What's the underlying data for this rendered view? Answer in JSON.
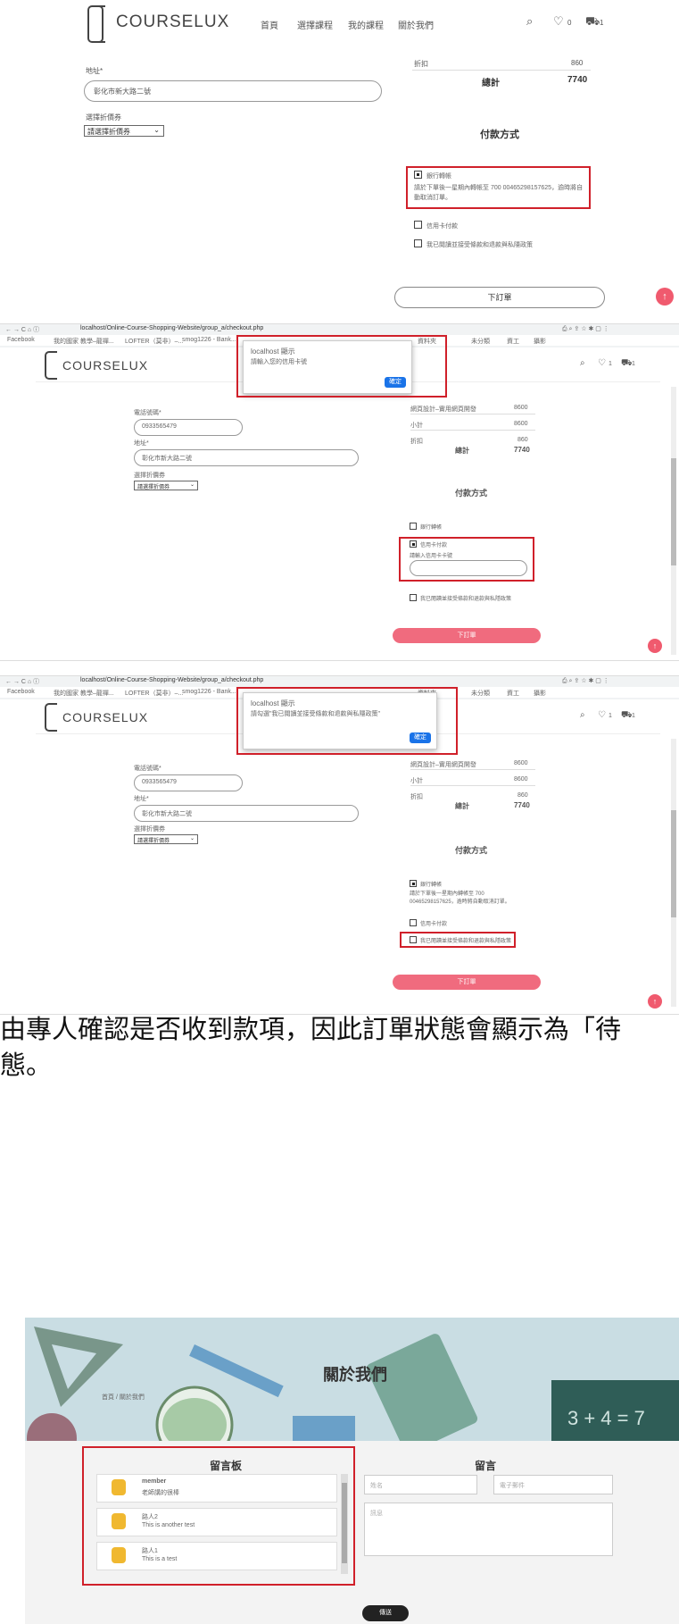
{
  "nav": {
    "logo": "COURSELUX",
    "items": [
      "首頁",
      "選擇課程",
      "我的課程",
      "關於我們"
    ],
    "wish_count_1": "0",
    "cart_count_1": "1",
    "wish_count_2": "1",
    "cart_count_2": "1"
  },
  "shot1": {
    "address_label": "地址*",
    "address_value": "彰化市新大路二號",
    "coupon_label": "選擇折價券",
    "coupon_value": "請選擇折價券",
    "discount_label": "折扣",
    "discount_value": "860",
    "total_label": "總計",
    "total_value": "7740",
    "payment_title": "付款方式",
    "opt_bank": "銀行轉帳",
    "bank_note": "請於下單後一星期內轉帳至 700 00465298157625，逾時將自動取消訂單。",
    "opt_card": "信用卡付款",
    "agree": "我已閱讀並接受條款和退款與私隱政策",
    "submit": "下訂單"
  },
  "shot2": {
    "url": "localhost/Online-Course-Shopping-Website/group_a/checkout.php",
    "bookmark_fb": "Facebook",
    "bookmark_2": "我的國家 教學–龍禪...",
    "bookmark_3": "LOFTER（莫非）–...",
    "bookmark_4": "smog1226 - Bank...",
    "bookmark_5": "資料夾",
    "bookmark_6": "未分類",
    "bookmark_7": "資工",
    "bookmark_8": "攝影",
    "dialog_title": "localhost 顯示",
    "dialog_msg": "請輸入您的信用卡號",
    "dialog_ok": "確定",
    "phone_label": "電話號碼*",
    "phone_value": "0933565479",
    "address_label": "地址*",
    "address_value": "彰化市新大路二號",
    "coupon_label": "選擇折價券",
    "coupon_value": "請選擇折價券",
    "item_row": "網頁設計–實用網頁開發",
    "item_price": "8600",
    "subtotal_label": "小計",
    "subtotal_value": "8600",
    "discount_label": "折扣",
    "discount_value": "860",
    "total_label": "總計",
    "total_value": "7740",
    "payment_title": "付款方式",
    "opt_bank": "銀行轉帳",
    "opt_card": "信用卡付款",
    "card_prompt": "請輸入信用卡卡號",
    "agree": "我已閱讀並接受條款和退款與私隱政策",
    "submit": "下訂單"
  },
  "shot3": {
    "dialog_title": "localhost 顯示",
    "dialog_msg": "請勾選\"我已閱讀並接受條款和退款與私隱政策\"",
    "dialog_ok": "確定",
    "bank_note": "請於下單後一星期內轉帳至 700 00465298157625，逾時將自動取消訂單。"
  },
  "para": {
    "line1": "由專人確認是否收到款項，因此訂單狀態會顯示為「待",
    "line2": "態。"
  },
  "shot4": {
    "hero_title": "關於我們",
    "breadcrumb": "首頁 / 關於我們",
    "board_title": "留言板",
    "comments": [
      {
        "name": "member",
        "text": "老師講的很棒"
      },
      {
        "name": "路人2",
        "text": "This is another test"
      },
      {
        "name": "路人1",
        "text": "This is a test"
      }
    ],
    "form_title": "留言",
    "name_placeholder": "姓名",
    "email_placeholder": "電子郵件",
    "message_placeholder": "訊息",
    "send": "傳送",
    "chalk_text": "3 + 4 = 7"
  },
  "colors": {
    "accent": "#f05a6e",
    "highlight": "#d0202a",
    "hero_bg": "#c9dde3",
    "chalkboard": "#2f5d57"
  }
}
